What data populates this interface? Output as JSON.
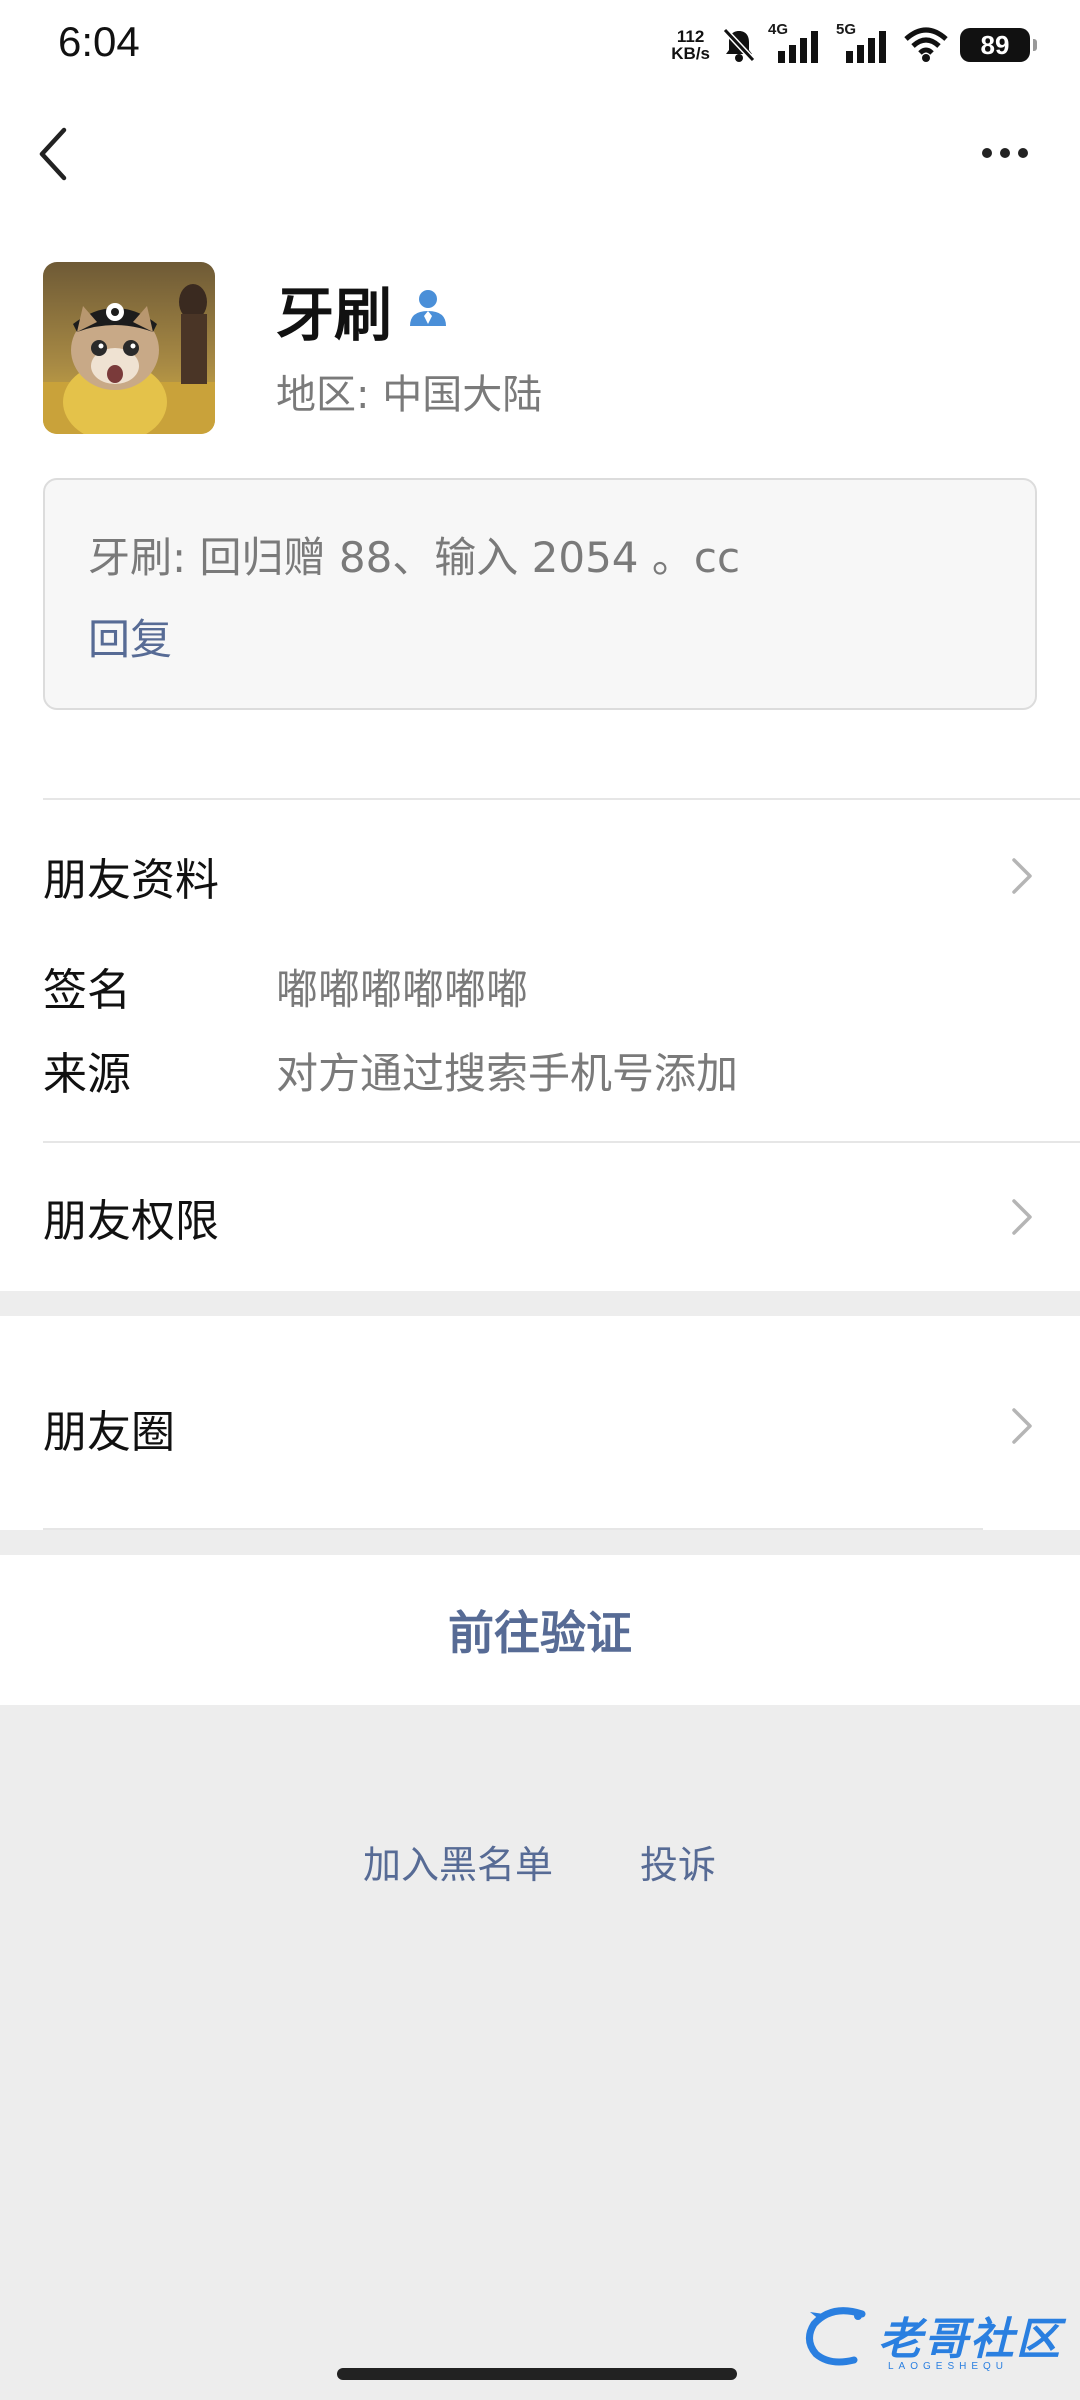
{
  "status_bar": {
    "time": "6:04",
    "net_speed_value": "112",
    "net_speed_unit": "KB/s",
    "signal_1": "4G",
    "signal_2": "5G",
    "battery": "89"
  },
  "header": {
    "back_icon": "chevron-left-icon",
    "more_icon": "more-dots-icon"
  },
  "profile": {
    "name": "牙刷",
    "name_icon": "person-badge-icon",
    "region": "地区:  中国大陆"
  },
  "message": {
    "text": "牙刷: 回归赠 88、输入 2054 。cc",
    "reply": "回复"
  },
  "sections": {
    "friend_profile": "朋友资料",
    "signature_label": "签名",
    "signature_value": "嘟嘟嘟嘟嘟嘟",
    "source_label": "来源",
    "source_value": "对方通过搜索手机号添加",
    "friend_permissions": "朋友权限",
    "moments": "朋友圈"
  },
  "actions": {
    "verify": "前往验证",
    "blacklist": "加入黑名单",
    "report": "投诉"
  },
  "watermark": {
    "text": "老哥社区",
    "sub": "LAOGESHEQU"
  },
  "colors": {
    "link": "#576b95",
    "background": "#ededed",
    "watermark": "#2a7fe0"
  }
}
